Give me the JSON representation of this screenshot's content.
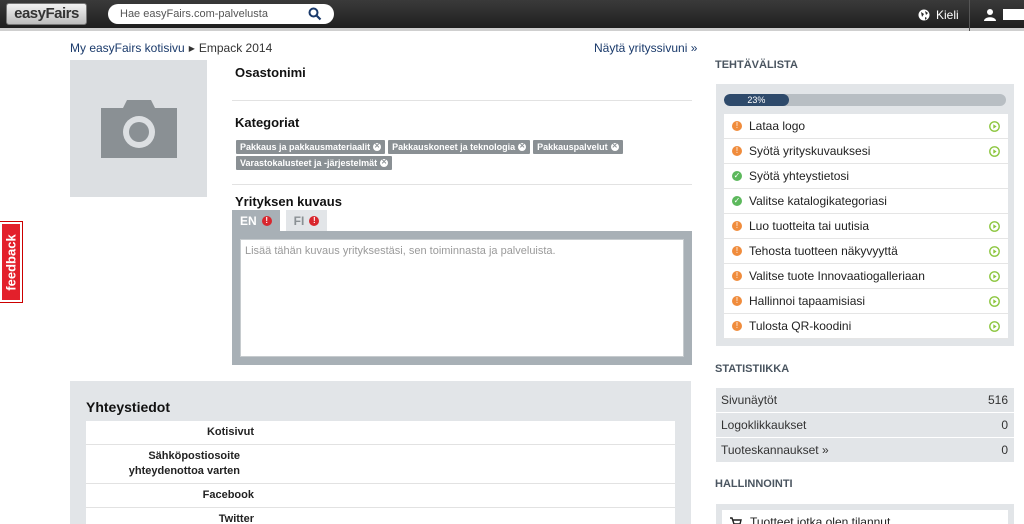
{
  "topbar": {
    "logo": "easyFairs",
    "search_placeholder": "Hae easyFairs.com-palvelusta",
    "language_label": "Kieli"
  },
  "breadcrumb": {
    "home": "My easyFairs kotisivu",
    "current": "Empack 2014",
    "show_page": "Näytä yrityssivuni »"
  },
  "profile": {
    "department_title": "Osastonimi",
    "categories_title": "Kategoriat",
    "categories": [
      "Pakkaus ja pakkausmateriaalit",
      "Pakkauskoneet ja teknologia",
      "Pakkauspalvelut",
      "Varastokalusteet ja -järjestelmät"
    ],
    "description_title": "Yrityksen kuvaus",
    "tabs": [
      "EN",
      "FI"
    ],
    "description_placeholder": "Lisää tähän kuvaus yrityksestäsi, sen toiminnasta ja palveluista."
  },
  "contact": {
    "title": "Yhteystiedot",
    "rows": [
      "Kotisivut",
      "Sähköpostiosoite yhteydenottoa varten",
      "Facebook",
      "Twitter"
    ]
  },
  "tasks": {
    "title": "TEHTÄVÄLISTA",
    "progress_label": "23%",
    "progress_value": 23,
    "items": [
      {
        "label": "Lataa logo",
        "status": "todo"
      },
      {
        "label": "Syötä yrityskuvauksesi",
        "status": "todo"
      },
      {
        "label": "Syötä yhteystietosi",
        "status": "done"
      },
      {
        "label": "Valitse katalogikategoriasi",
        "status": "done"
      },
      {
        "label": "Luo tuotteita tai uutisia",
        "status": "todo"
      },
      {
        "label": "Tehosta tuotteen näkyvyyttä",
        "status": "todo"
      },
      {
        "label": "Valitse tuote Innovaatiogalleriaan",
        "status": "todo"
      },
      {
        "label": "Hallinnoi tapaamisiasi",
        "status": "todo"
      },
      {
        "label": "Tulosta QR-koodini",
        "status": "todo"
      }
    ]
  },
  "stats": {
    "title": "STATISTIIKKA",
    "rows": [
      {
        "label": "Sivunäytöt",
        "value": "516"
      },
      {
        "label": "Logoklikkaukset",
        "value": "0"
      },
      {
        "label": "Tuoteskannaukset »",
        "value": "0"
      }
    ]
  },
  "manage": {
    "title": "HALLINNOINTI",
    "item": "Tuotteet jotka olen tilannut"
  },
  "feedback": "feedback"
}
